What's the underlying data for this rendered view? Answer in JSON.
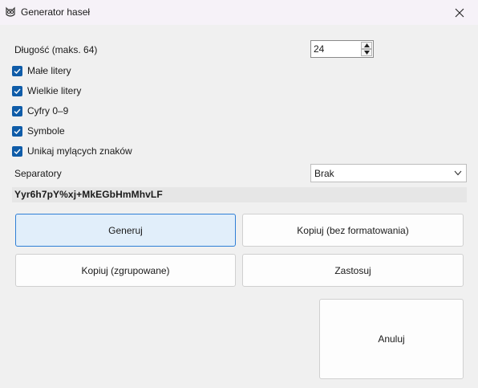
{
  "window": {
    "title": "Generator haseł",
    "app_icon": "owl-icon",
    "close_icon": "close-icon"
  },
  "length": {
    "label": "Długość (maks. 64)",
    "value": "24"
  },
  "options": [
    {
      "label": "Małe litery",
      "checked": true
    },
    {
      "label": "Wielkie litery",
      "checked": true
    },
    {
      "label": "Cyfry 0–9",
      "checked": true
    },
    {
      "label": "Symbole",
      "checked": true
    },
    {
      "label": "Unikaj mylących znaków",
      "checked": true
    }
  ],
  "separators": {
    "label": "Separatory",
    "value": "Brak"
  },
  "password": "Yyr6h7pY%xj+MkEGbHmMhvLF",
  "buttons": {
    "generate": "Generuj",
    "copy_plain": "Kopiuj (bez formatowania)",
    "copy_grouped": "Kopiuj (zgrupowane)",
    "apply": "Zastosuj",
    "cancel": "Anuluj"
  },
  "colors": {
    "accent": "#0f5ca8",
    "primary_button_bg": "#e1eefa",
    "primary_button_border": "#2f7fd6"
  }
}
